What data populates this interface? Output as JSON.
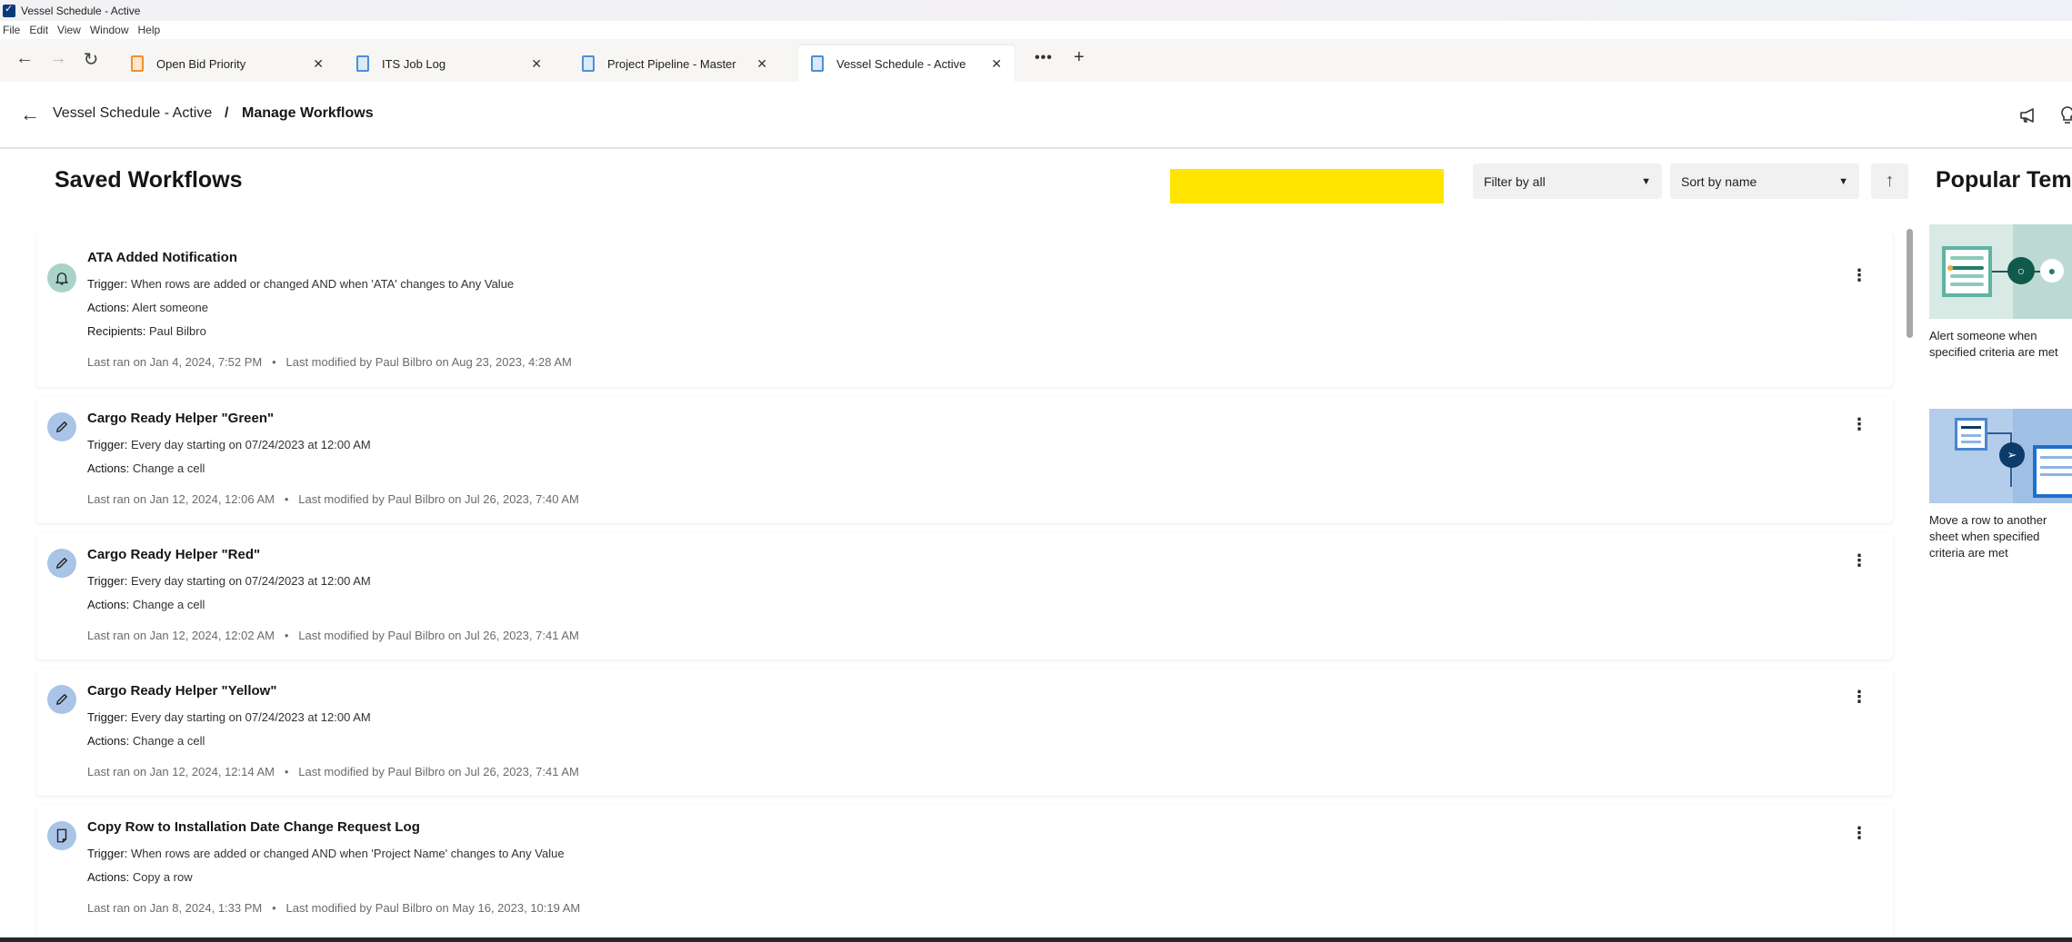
{
  "window": {
    "title": "Vessel Schedule - Active"
  },
  "menu": [
    "File",
    "Edit",
    "View",
    "Window",
    "Help"
  ],
  "tabs": [
    {
      "label": "Open Bid Priority",
      "icon": "notebook-icon",
      "active": false
    },
    {
      "label": "ITS Job Log",
      "icon": "sheet-icon",
      "active": false
    },
    {
      "label": "Project Pipeline - Master",
      "icon": "sheet-icon",
      "active": false
    },
    {
      "label": "Vessel Schedule - Active",
      "icon": "sheet-icon",
      "active": true
    }
  ],
  "tabbar": {
    "more": "•••",
    "add": "+",
    "close": "✕"
  },
  "breadcrumb": {
    "parent": "Vessel Schedule - Active",
    "separator": "/",
    "current": "Manage Workflows"
  },
  "header": {
    "title": "Saved Workflows",
    "filter": "Filter by all",
    "sort": "Sort by name",
    "sort_direction": "ascending"
  },
  "workflows": [
    {
      "name": "ATA Added Notification",
      "icon": "bell-icon",
      "icon_color": "#a9d3c9",
      "trigger_label": "Trigger:",
      "trigger": "When rows are added or changed AND when 'ATA' changes to Any Value",
      "actions_label": "Actions:",
      "actions": "Alert someone",
      "recipients_label": "Recipients:",
      "recipients": "Paul Bilbro",
      "last_ran": "Last ran on Jan 4, 2024, 7:52 PM",
      "last_modified": "Last modified by Paul Bilbro on Aug 23, 2023, 4:28 AM"
    },
    {
      "name": "Cargo Ready Helper \"Green\"",
      "icon": "pencil-icon",
      "icon_color": "#a9c4e6",
      "trigger_label": "Trigger:",
      "trigger": "Every day starting on 07/24/2023 at 12:00 AM",
      "actions_label": "Actions:",
      "actions": "Change a cell",
      "last_ran": "Last ran on Jan 12, 2024, 12:06 AM",
      "last_modified": "Last modified by Paul Bilbro on Jul 26, 2023, 7:40 AM"
    },
    {
      "name": "Cargo Ready Helper \"Red\"",
      "icon": "pencil-icon",
      "icon_color": "#a9c4e6",
      "trigger_label": "Trigger:",
      "trigger": "Every day starting on 07/24/2023 at 12:00 AM",
      "actions_label": "Actions:",
      "actions": "Change a cell",
      "last_ran": "Last ran on Jan 12, 2024, 12:02 AM",
      "last_modified": "Last modified by Paul Bilbro on Jul 26, 2023, 7:41 AM"
    },
    {
      "name": "Cargo Ready Helper \"Yellow\"",
      "icon": "pencil-icon",
      "icon_color": "#a9c4e6",
      "trigger_label": "Trigger:",
      "trigger": "Every day starting on 07/24/2023 at 12:00 AM",
      "actions_label": "Actions:",
      "actions": "Change a cell",
      "last_ran": "Last ran on Jan 12, 2024, 12:14 AM",
      "last_modified": "Last modified by Paul Bilbro on Jul 26, 2023, 7:41 AM"
    },
    {
      "name": "Copy Row to Installation Date Change Request Log",
      "icon": "copy-row-icon",
      "icon_color": "#a9c4e6",
      "trigger_label": "Trigger:",
      "trigger": "When rows are added or changed AND when 'Project Name' changes to Any Value",
      "actions_label": "Actions:",
      "actions": "Copy a row",
      "last_ran": "Last ran on Jan 8, 2024, 1:33 PM",
      "last_modified": "Last modified by Paul Bilbro on May 16, 2023, 10:19 AM"
    }
  ],
  "meta_separator": "•",
  "popular": {
    "title": "Popular Templates",
    "templates": [
      {
        "caption": "Alert someone when specified criteria are met",
        "theme": "green"
      },
      {
        "caption": "Move a row to another sheet when specified criteria are met",
        "theme": "blue"
      }
    ]
  },
  "colors": {
    "accent_green": "#0f5a4a",
    "accent_blue": "#0b3a6b",
    "redaction": "#ffe500"
  }
}
